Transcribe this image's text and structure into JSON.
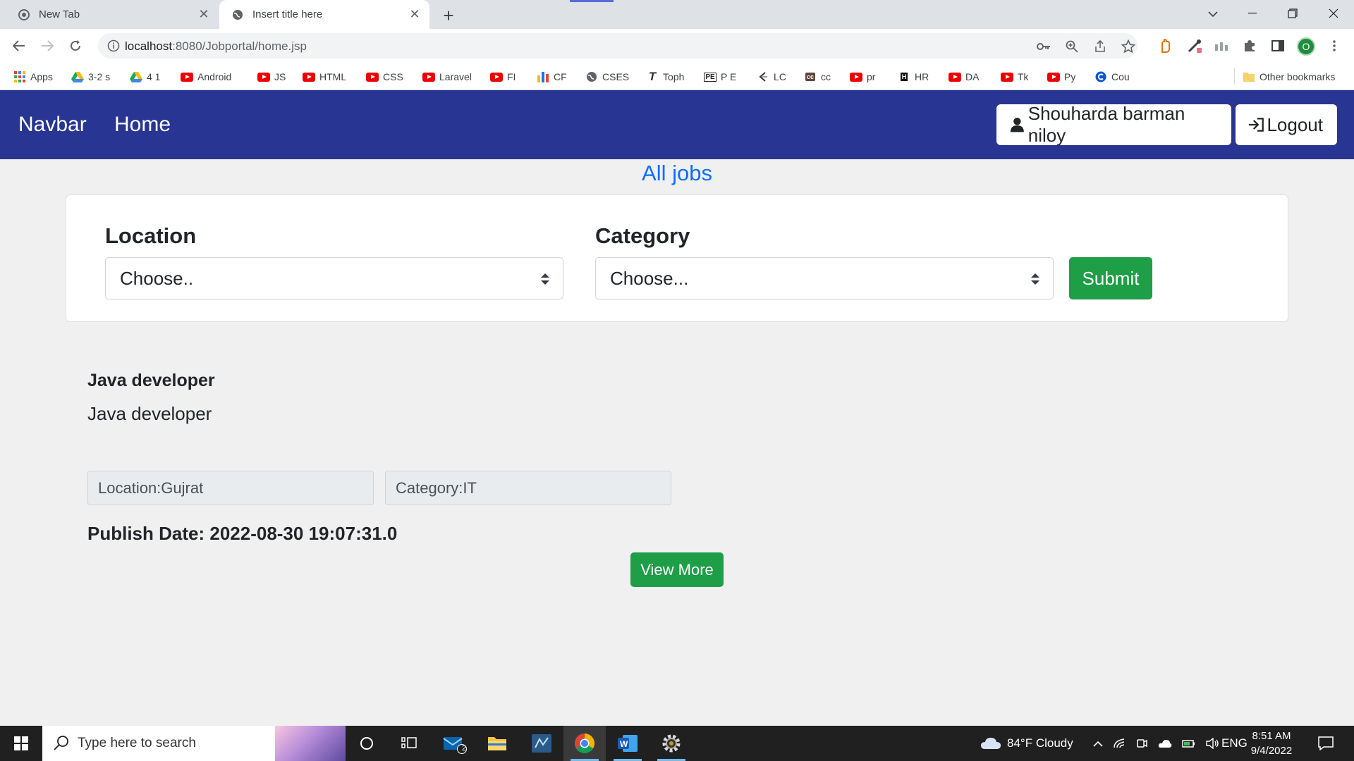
{
  "browser": {
    "tabs": [
      {
        "title": "New Tab"
      },
      {
        "title": "Insert title here"
      }
    ],
    "url_host": "localhost",
    "url_rest": ":8080/Jobportal/home.jsp",
    "bookmarks": [
      "Apps",
      "3-2 s",
      "4 1",
      "Android",
      "JS",
      "HTML",
      "CSS",
      "Laravel",
      "FI",
      "CF",
      "CSES",
      "Toph",
      "P E",
      "LC",
      "cc",
      "pr",
      "HR",
      "DA",
      "Tk",
      "Py",
      "Cou"
    ],
    "other_bookmarks": "Other bookmarks",
    "profile_initial": "O"
  },
  "navbar": {
    "brand": "Navbar",
    "home_link": "Home",
    "user_button": "Shouharda barman niloy",
    "logout_button": "Logout",
    "bg_color": "#283593"
  },
  "page": {
    "title": "All jobs",
    "filters": {
      "location_label": "Location",
      "location_value": "Choose..",
      "category_label": "Category",
      "category_value": "Choose...",
      "submit_label": "Submit"
    },
    "jobs": [
      {
        "title": "Java developer",
        "description": "Java developer",
        "location": "Location:Gujrat",
        "category": "Category:IT",
        "publish_date": "Publish Date: 2022-08-30 19:07:31.0",
        "view_more_label": "View More"
      }
    ]
  },
  "taskbar": {
    "search_placeholder": "Type here to search",
    "mail_badge": "2",
    "weather": "84°F  Cloudy",
    "language": "ENG",
    "time": "8:51 AM",
    "date": "9/4/2022"
  }
}
